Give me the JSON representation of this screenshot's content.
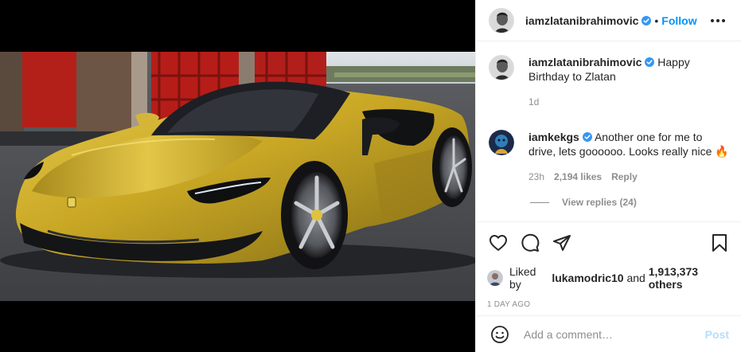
{
  "colors": {
    "accent": "#0095f6",
    "verified": "#3897f0",
    "post_disabled": "#b2dffc",
    "muted": "#8e8e8e",
    "car_gold": "#c9a725"
  },
  "header": {
    "username": "iamzlatanibrahimovic",
    "separator": "•",
    "follow_label": "Follow"
  },
  "caption": {
    "username": "iamzlatanibrahimovic",
    "text": "Happy Birthday to Zlatan",
    "time": "1d"
  },
  "comments": [
    {
      "username": "iamkekgs",
      "text": "Another one for me to drive, lets goooooo. Looks really nice 🔥",
      "time": "23h",
      "likes": "2,194 likes",
      "reply_label": "Reply",
      "view_replies": "View replies (24)"
    }
  ],
  "likes": {
    "prefix": "Liked by",
    "user": "lukamodric10",
    "joiner": "and",
    "others": "1,913,373 others"
  },
  "date": "1 DAY AGO",
  "add_comment": {
    "placeholder": "Add a comment…",
    "post_label": "Post"
  },
  "icons": {
    "avatar": "profile-avatar",
    "verified": "verified-badge-icon",
    "more": "more-options-icon",
    "like": "heart-icon",
    "comment": "comment-icon",
    "share": "share-icon",
    "save": "bookmark-icon",
    "emoji": "emoji-icon"
  }
}
